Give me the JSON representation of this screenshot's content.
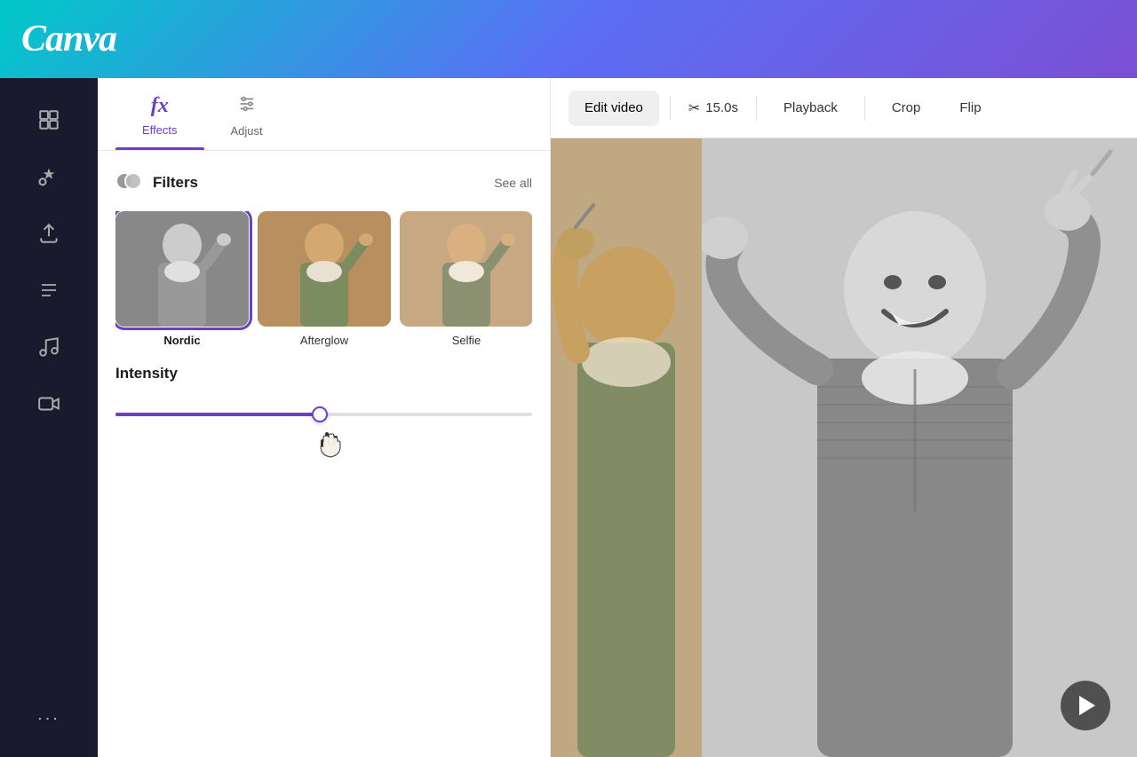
{
  "header": {
    "logo": "Canva"
  },
  "sidebar": {
    "icons": [
      {
        "name": "layout-icon",
        "symbol": "⊞",
        "label": "Layout"
      },
      {
        "name": "elements-icon",
        "symbol": "❤△",
        "label": "Elements"
      },
      {
        "name": "uploads-icon",
        "symbol": "↑",
        "label": "Uploads"
      },
      {
        "name": "text-icon",
        "symbol": "T",
        "label": "Text"
      },
      {
        "name": "audio-icon",
        "symbol": "♫",
        "label": "Audio"
      },
      {
        "name": "video-icon",
        "symbol": "▶",
        "label": "Video"
      }
    ],
    "more_label": "..."
  },
  "panel": {
    "tabs": [
      {
        "name": "effects-tab",
        "label": "Effects",
        "active": true
      },
      {
        "name": "adjust-tab",
        "label": "Adjust",
        "active": false
      }
    ],
    "filters_section": {
      "title": "Filters",
      "see_all_label": "See all",
      "items": [
        {
          "name": "Nordic",
          "active": true
        },
        {
          "name": "Afterglow",
          "active": false
        },
        {
          "name": "Selfie",
          "active": false
        },
        {
          "name": "",
          "partial": true
        }
      ]
    },
    "intensity_section": {
      "label": "Intensity",
      "value": 49
    }
  },
  "toolbar": {
    "edit_video_label": "Edit video",
    "duration_label": "15.0s",
    "playback_label": "Playback",
    "crop_label": "Crop",
    "flip_label": "Flip"
  },
  "video": {
    "play_label": "Play"
  }
}
